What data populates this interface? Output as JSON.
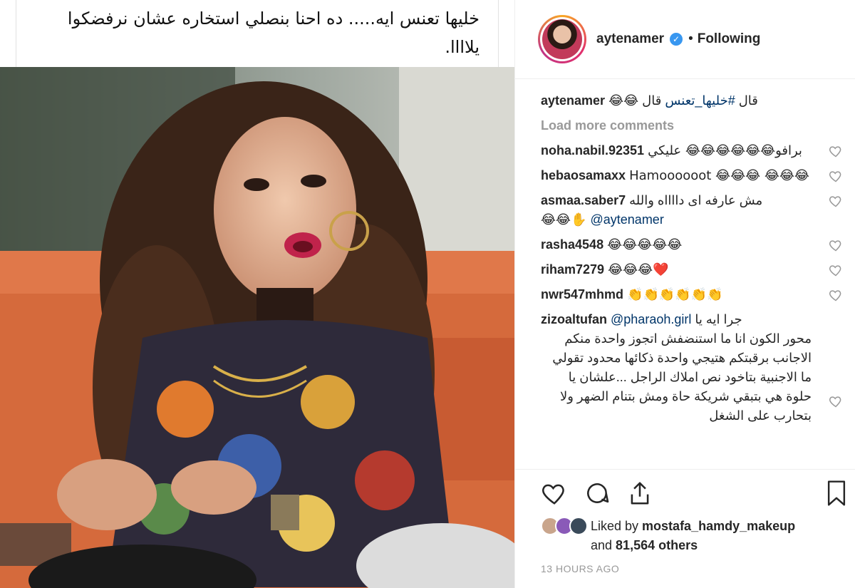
{
  "caption_overlay": "خليها تعنس ايه..... ده احنا بنصلي استخاره عشان نرفضكوا يلاااا.",
  "header": {
    "username": "aytenamer",
    "verified_icon": "verified-badge-icon",
    "separator": "•",
    "follow_status": "Following"
  },
  "caption": {
    "username": "aytenamer",
    "text_before": "قال ",
    "hashtag": "#خليها_تعنس",
    "text_after": " قال 😂😂"
  },
  "load_more": "Load more comments",
  "comments": [
    {
      "username": "noha.nabil.92351",
      "text": "برافو😂😂😂😂😂😂 عليكي"
    },
    {
      "username": "hebaosamaxx",
      "text": "Hamoooooot 😂😂😂 😂😂😂"
    },
    {
      "username": "asmaa.saber7",
      "text": "مش عارفه اى دااااه والله",
      "text2": "😂😂✋",
      "mention": "@aytenamer"
    },
    {
      "username": "rasha4548",
      "text": "😂😂😂😂😂"
    },
    {
      "username": "riham7279",
      "text": "😂😂😂❤️"
    },
    {
      "username": "nwr547mhmd",
      "text": "👏👏👏👏👏👏"
    },
    {
      "username": "zizoaltufan",
      "mention": "@pharaoh.girl",
      "text": "جرا ايه يا",
      "long_text": "محور الكون انا ما استنضفش اتجوز واحدة منكم الاجانب برقبتكم هتيجي واحدة ذكائها محدود تقولي ما الاجنبية بتاخود نص املاك الراجل ...علشان يا حلوة هي بتبقي شريكة حاة ومش بتنام الضهر ولا بتحارب على الشغل"
    }
  ],
  "actions": {
    "like_icon": "heart-icon",
    "comment_icon": "comment-icon",
    "share_icon": "share-icon",
    "save_icon": "bookmark-icon"
  },
  "likes": {
    "prefix": "Liked by ",
    "user": "mostafa_hamdy_makeup",
    "and": "and ",
    "count": "81,564 others"
  },
  "timestamp": "13 HOURS AGO",
  "colors": {
    "link": "#003569",
    "muted": "#999999",
    "verified": "#3897f0",
    "heart_red": "#ed4956"
  }
}
